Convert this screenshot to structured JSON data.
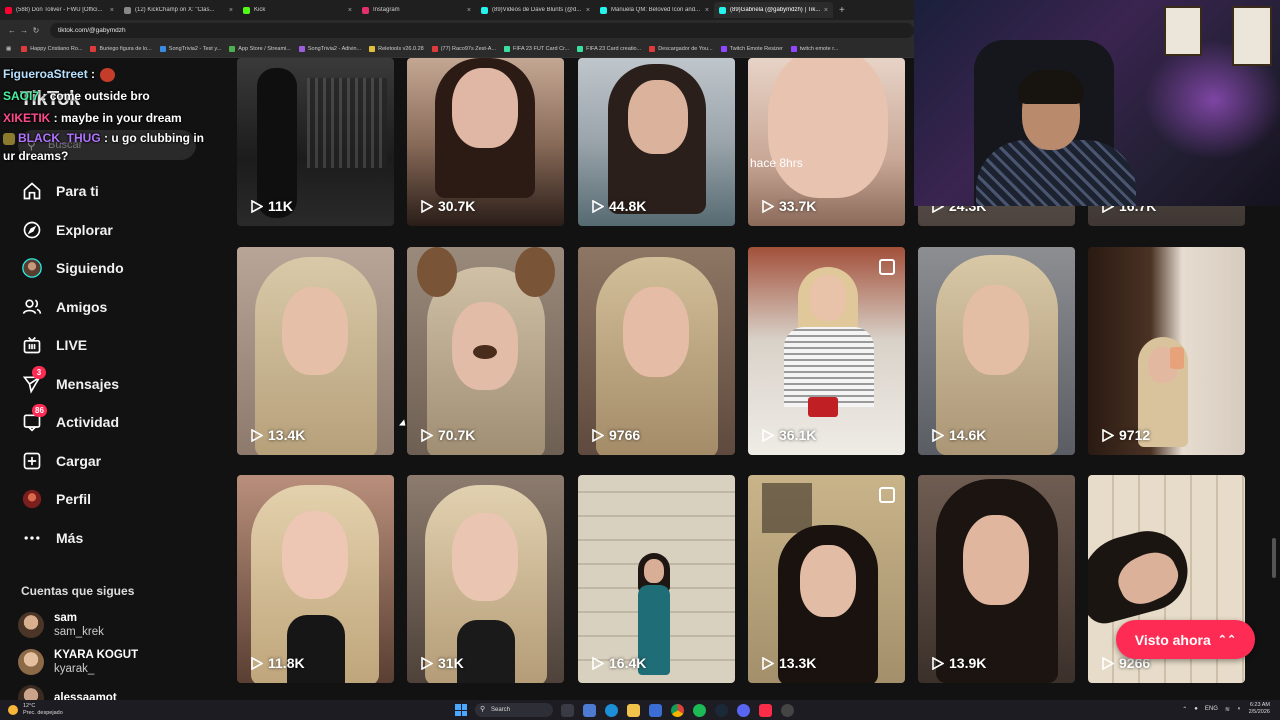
{
  "browser": {
    "tabs": [
      {
        "label": "(588) Don Toliver - FWU [Offici...",
        "color": "#ff0033",
        "active": false
      },
      {
        "label": "(12) KickChamp on X: \"Clas...",
        "color": "#888888",
        "active": false
      },
      {
        "label": "Kick",
        "color": "#53fc18",
        "active": false
      },
      {
        "label": "Instagram",
        "color": "#e1306c",
        "active": false
      },
      {
        "label": "(89)Videos de Dave Blunts (@d...",
        "color": "#25f4ee",
        "active": false
      },
      {
        "label": "Manuela QM: Beloved Icon and...",
        "color": "#25f4ee",
        "active": false
      },
      {
        "label": "(89)Gabriela (@gabymdzh) | Tik...",
        "color": "#25f4ee",
        "active": true
      }
    ],
    "new_tab": "+",
    "url": "tiktok.com/@gabymdzh",
    "bookmarks": [
      {
        "label": "Happy Cristiano Ro...",
        "color": "#e03b3b"
      },
      {
        "label": "Buriego figura de lo...",
        "color": "#e03b3b"
      },
      {
        "label": "SongTrivia2 - Test y...",
        "color": "#3b8be0"
      },
      {
        "label": "App Store / Streami...",
        "color": "#4caf50"
      },
      {
        "label": "SongTrivia2 - Adivin...",
        "color": "#9c5de0"
      },
      {
        "label": "Reletools v26.0.28",
        "color": "#e0c03b"
      },
      {
        "label": "(77) Raco97s Zest-A...",
        "color": "#e03b3b"
      },
      {
        "label": "FIFA 23 FUT Card Cr...",
        "color": "#3be0a0"
      },
      {
        "label": "FIFA 23 Card creatio...",
        "color": "#3be0a0"
      },
      {
        "label": "Descargador de You...",
        "color": "#e03b3b"
      },
      {
        "label": "Twitch Emote Resizer",
        "color": "#9146ff"
      },
      {
        "label": "twitch emote r...",
        "color": "#9146ff"
      }
    ]
  },
  "sidebar": {
    "logo": "TikTok",
    "search_placeholder": "Buscar",
    "nav": [
      {
        "label": "Para ti",
        "icon": "home-icon"
      },
      {
        "label": "Explorar",
        "icon": "compass-icon"
      },
      {
        "label": "Siguiendo",
        "icon": "avatar"
      },
      {
        "label": "Amigos",
        "icon": "friends-icon"
      },
      {
        "label": "LIVE",
        "icon": "live-tv-icon"
      },
      {
        "label": "Mensajes",
        "icon": "send-icon",
        "badge": "3"
      },
      {
        "label": "Actividad",
        "icon": "inbox-icon",
        "badge": "86"
      },
      {
        "label": "Cargar",
        "icon": "plus-square-icon"
      },
      {
        "label": "Perfil",
        "icon": "profile-avatar"
      },
      {
        "label": "Más",
        "icon": "more-icon"
      }
    ],
    "following_title": "Cuentas que sigues",
    "following": [
      {
        "name": "sam",
        "handle": "sam_krek"
      },
      {
        "name": "KYARA KOGUT",
        "handle": "kyarak_"
      },
      {
        "name": "alessaamot",
        "handle": ""
      }
    ]
  },
  "chat": [
    {
      "user": "FigueroaStreet",
      "message": ""
    },
    {
      "user": "SAOI7",
      "message": "come outside bro"
    },
    {
      "user": "XIKETIK",
      "message": "maybe in your dream"
    },
    {
      "user": "BLACK_THUG",
      "message": "u go clubbing in ur dreams?"
    }
  ],
  "videos": [
    {
      "views": "11K",
      "multi": false
    },
    {
      "views": "30.7K",
      "multi": false
    },
    {
      "views": "44.8K",
      "multi": false
    },
    {
      "views": "33.7K",
      "multi": false
    },
    {
      "views": "24.3K",
      "multi": false
    },
    {
      "views": "16.7K",
      "multi": false
    },
    {
      "views": "13.4K",
      "multi": false
    },
    {
      "views": "70.7K",
      "multi": false
    },
    {
      "views": "9766",
      "multi": false
    },
    {
      "views": "36.1K",
      "multi": true
    },
    {
      "views": "14.6K",
      "multi": false
    },
    {
      "views": "9712",
      "multi": false
    },
    {
      "views": "11.8K",
      "multi": false
    },
    {
      "views": "31K",
      "multi": false
    },
    {
      "views": "16.4K",
      "multi": false
    },
    {
      "views": "13.3K",
      "multi": true
    },
    {
      "views": "13.9K",
      "multi": false
    },
    {
      "views": "9266",
      "multi": false
    }
  ],
  "overlay_text": {
    "hace": "hace 8hrs"
  },
  "visto_ahora": {
    "label": "Visto ahora",
    "arrow": "⌃⌃"
  },
  "taskbar": {
    "weather_temp": "12°C",
    "weather_desc": "Prec. despejado",
    "search_label": "Search",
    "lang": "ENG",
    "time": "6:23 AM",
    "date": "2/5/2026"
  },
  "colors": {
    "accent": "#fe2c55",
    "background": "#121212"
  }
}
